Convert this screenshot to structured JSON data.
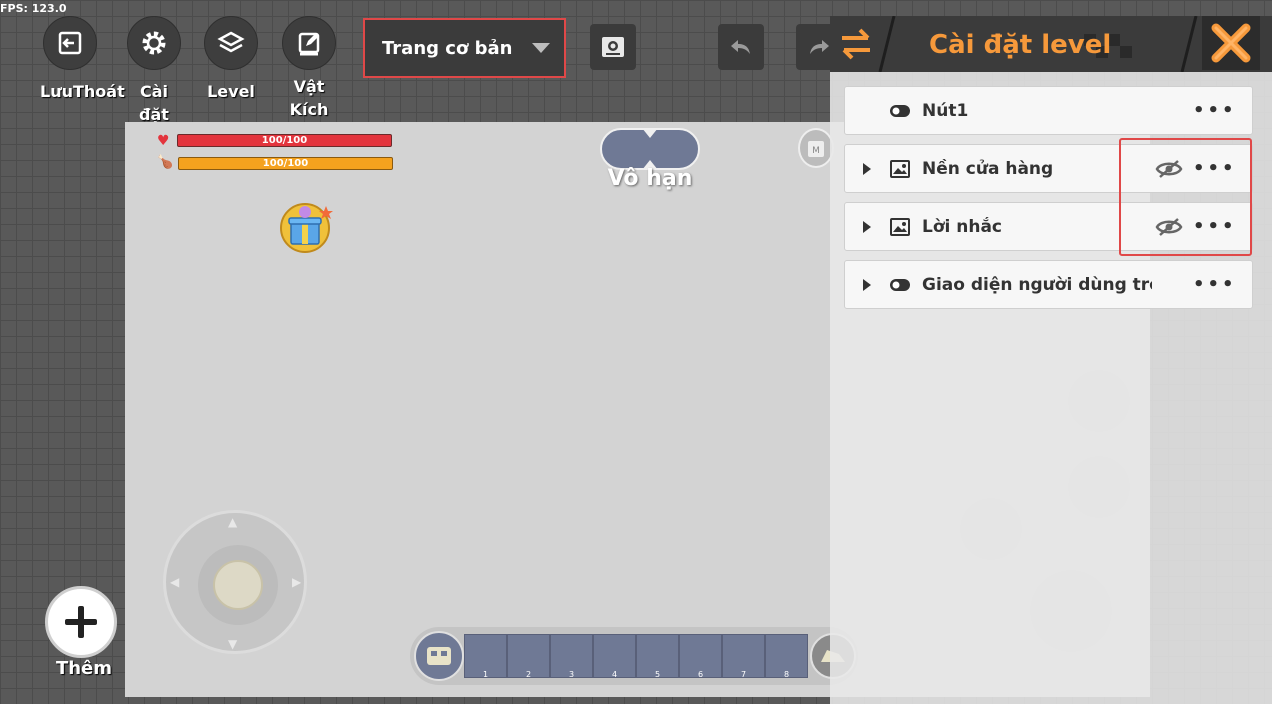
{
  "fps": "FPS: 123.0",
  "toolbar": {
    "items": [
      {
        "label": "LưuThoát",
        "icon": "exit-icon"
      },
      {
        "label": "Cài đặt",
        "icon": "gear-icon"
      },
      {
        "label": "Level",
        "icon": "layers-icon"
      },
      {
        "label": "Vật Kích Hoạt",
        "icon": "edit-icon"
      }
    ],
    "page_select": {
      "value": "Trang cơ bản"
    }
  },
  "hud": {
    "health": "100/100",
    "hunger": "100/100",
    "mode": "Vô hạn"
  },
  "hotbar": {
    "slots": [
      "1",
      "2",
      "3",
      "4",
      "5",
      "6",
      "7",
      "8"
    ]
  },
  "add": {
    "label": "Thêm"
  },
  "panel": {
    "title": "Cài đặt level",
    "items": [
      {
        "name": "Nút1",
        "icon": "toggle-icon",
        "expandable": false,
        "hidden": false
      },
      {
        "name": "Nền cửa hàng",
        "icon": "image-icon",
        "expandable": true,
        "hidden": true
      },
      {
        "name": "Lời nhắc",
        "icon": "image-icon",
        "expandable": true,
        "hidden": true
      },
      {
        "name": "Giao diện người dùng trong t",
        "icon": "toggle-icon",
        "expandable": true,
        "hidden": false
      }
    ],
    "more_glyph": "•••"
  },
  "colors": {
    "accent": "#f6993b",
    "highlight": "#e04848",
    "health": "#e3343d",
    "hunger": "#f5a21e",
    "slot": "#6f7995"
  }
}
